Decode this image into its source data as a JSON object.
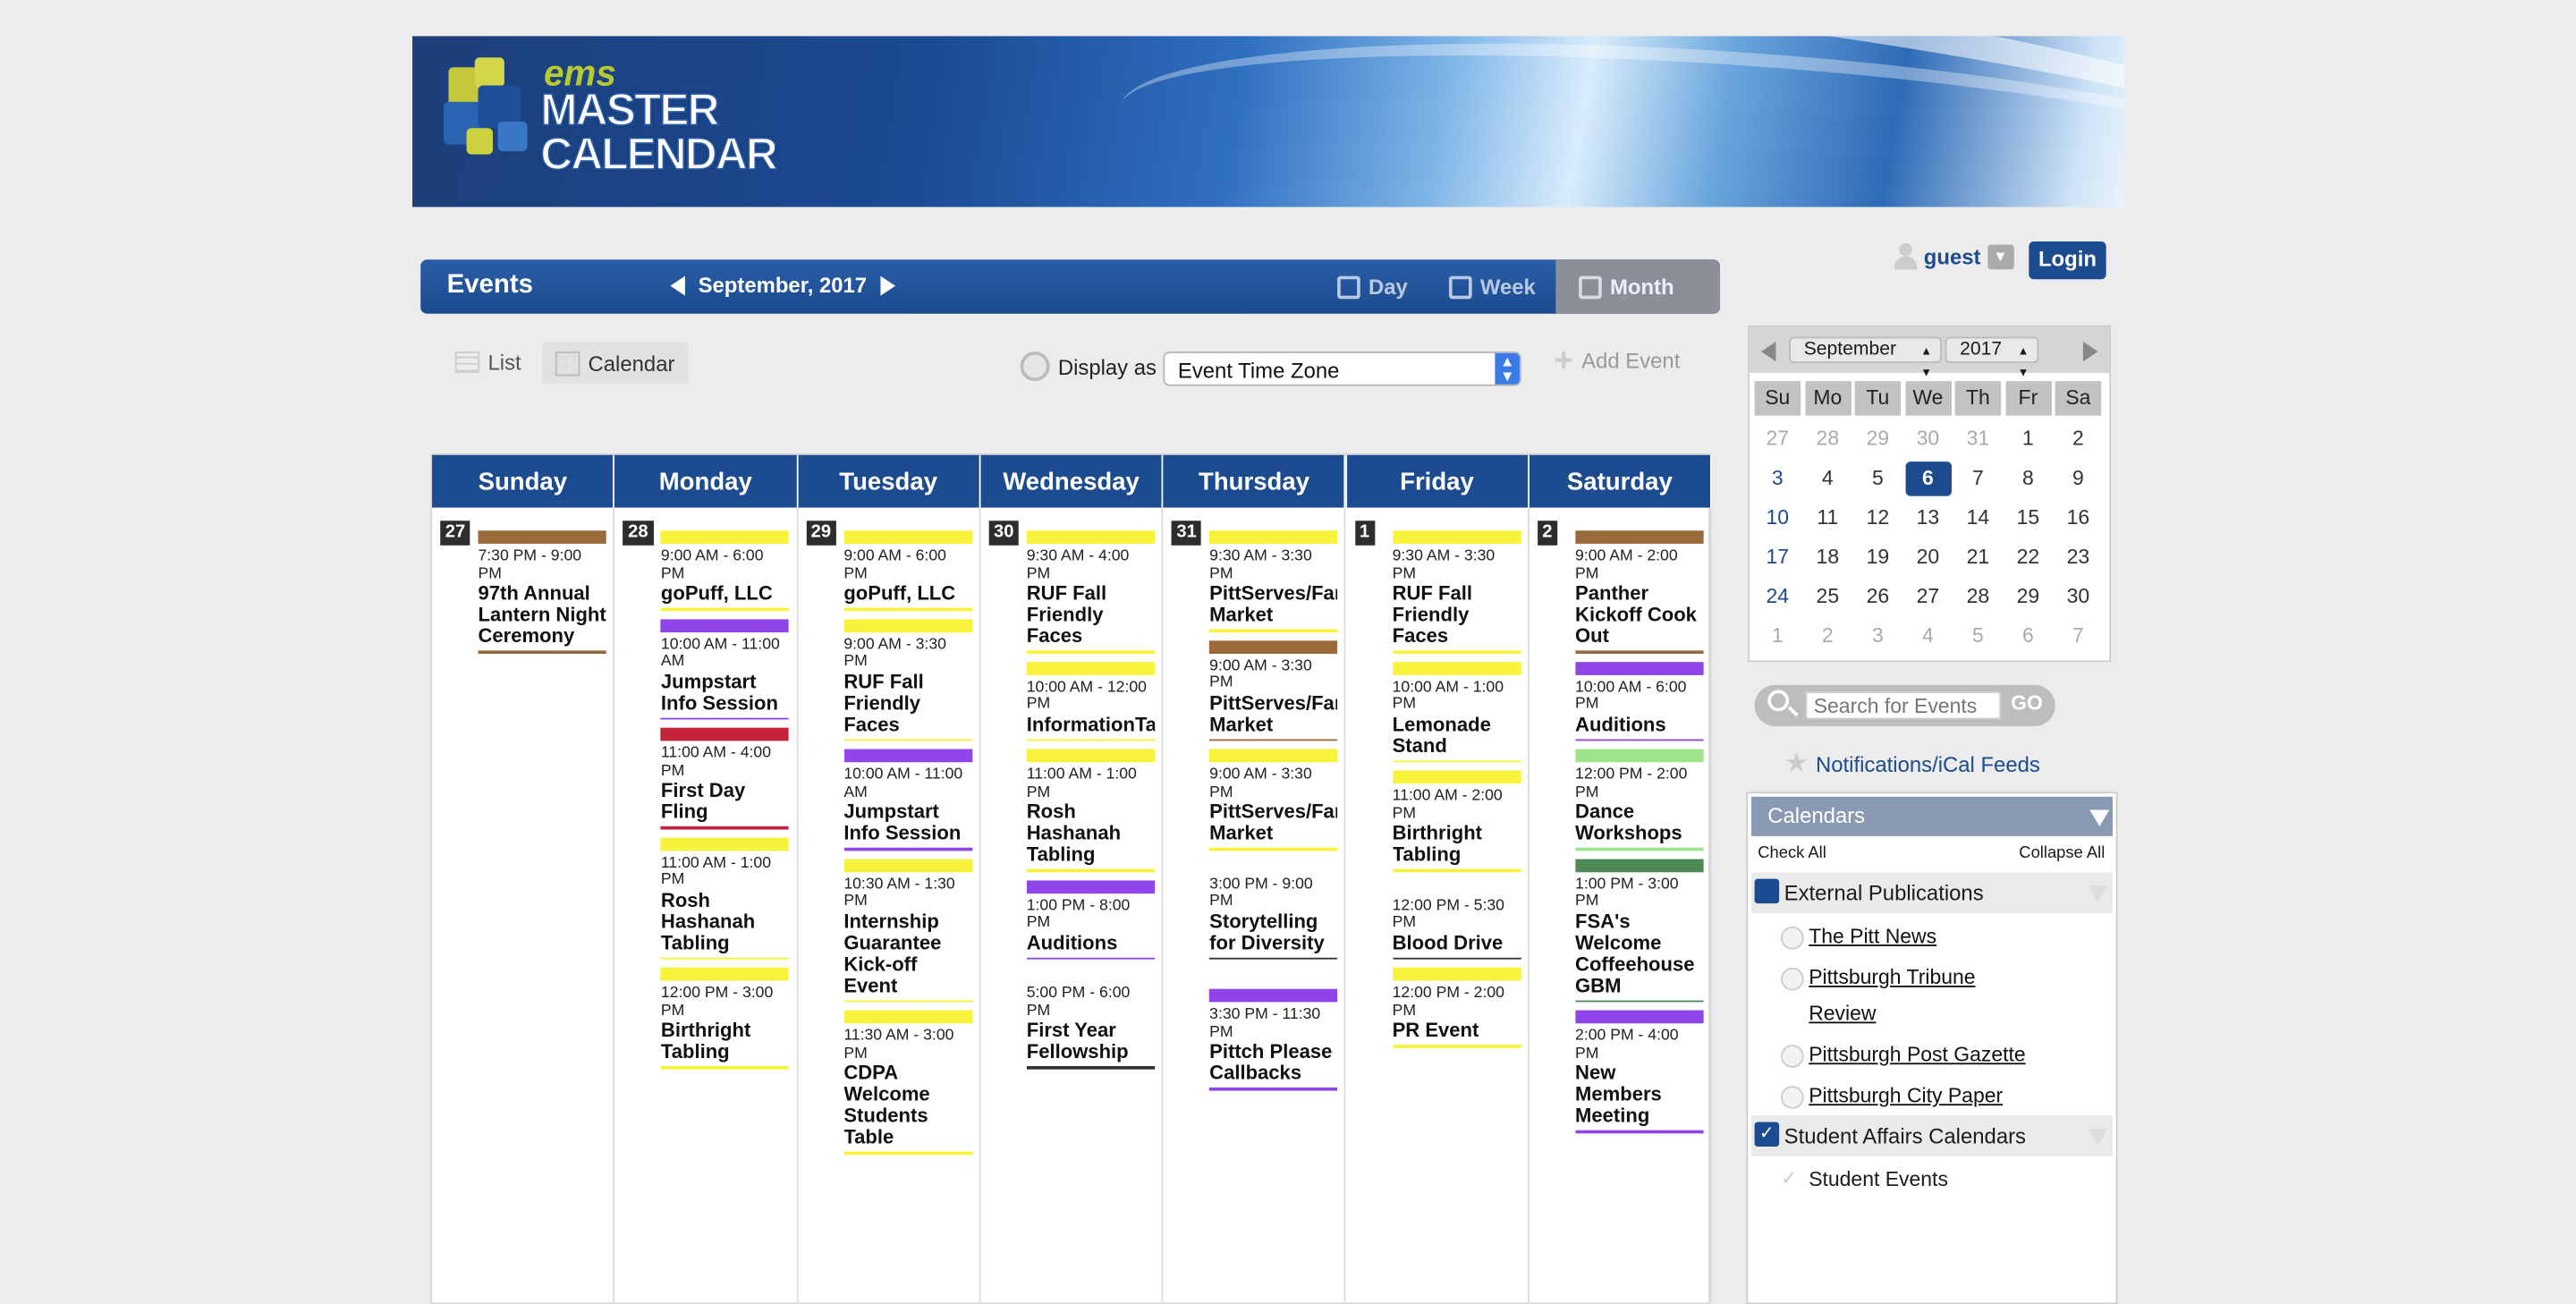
{
  "banner": {
    "logo_small": "ems",
    "logo_line1": "MASTER",
    "logo_line2": "CALENDAR"
  },
  "header": {
    "title": "Events",
    "month_label": "September, 2017",
    "views": [
      "Day",
      "Week",
      "Month"
    ],
    "active_view": "Month"
  },
  "toolbar": {
    "list_label": "List",
    "calendar_label": "Calendar",
    "display_as_label": "Display as",
    "timezone_value": "Event Time Zone",
    "add_event_label": "Add Event"
  },
  "user": {
    "name": "guest",
    "login_label": "Login"
  },
  "calendar": {
    "day_headers": [
      "Sunday",
      "Monday",
      "Tuesday",
      "Wednesday",
      "Thursday",
      "Friday",
      "Saturday"
    ],
    "days": [
      {
        "num": "27",
        "events": [
          {
            "time": "7:30 PM - 9:00 PM",
            "name": "97th Annual Lantern Night Ceremony",
            "color": "#9b6a3a"
          }
        ]
      },
      {
        "num": "28",
        "events": [
          {
            "time": "9:00 AM - 6:00 PM",
            "name": "goPuff, LLC",
            "color": "#f7f33b"
          },
          {
            "time": "10:00 AM - 11:00 AM",
            "name": "Jumpstart Info Session",
            "color": "#9045e8"
          },
          {
            "time": "11:00 AM - 4:00 PM",
            "name": "First Day Fling",
            "color": "#c4223b"
          },
          {
            "time": "11:00 AM - 1:00 PM",
            "name": "Rosh Hashanah Tabling",
            "color": "#f7f33b"
          },
          {
            "time": "12:00 PM - 3:00 PM",
            "name": "Birthright Tabling",
            "color": "#f7f33b"
          }
        ]
      },
      {
        "num": "29",
        "events": [
          {
            "time": "9:00 AM - 6:00 PM",
            "name": "goPuff, LLC",
            "color": "#f7f33b"
          },
          {
            "time": "9:00 AM - 3:30 PM",
            "name": "RUF Fall Friendly Faces",
            "color": "#f7f33b"
          },
          {
            "time": "10:00 AM - 11:00 AM",
            "name": "Jumpstart Info Session",
            "color": "#9045e8"
          },
          {
            "time": "10:30 AM - 1:30 PM",
            "name": "Internship Guarantee Kick-off Event",
            "color": "#f7f33b"
          },
          {
            "time": "11:30 AM - 3:00 PM",
            "name": "CDPA Welcome Students Table",
            "color": "#f7f33b"
          }
        ]
      },
      {
        "num": "30",
        "events": [
          {
            "time": "9:30 AM - 4:00 PM",
            "name": "RUF Fall Friendly Faces",
            "color": "#f7f33b"
          },
          {
            "time": "10:00 AM - 12:00 PM",
            "name": "InformationTabl",
            "color": "#f7f33b"
          },
          {
            "time": "11:00 AM - 1:00 PM",
            "name": "Rosh Hashanah Tabling",
            "color": "#f7f33b"
          },
          {
            "time": "1:00 PM - 8:00 PM",
            "name": "Auditions",
            "color": "#9045e8"
          },
          {
            "time": "5:00 PM - 6:00 PM",
            "name": "First Year Fellowship",
            "color": "#ffffff"
          }
        ]
      },
      {
        "num": "31",
        "events": [
          {
            "time": "9:30 AM - 3:30 PM",
            "name": "PittServes/Far Market",
            "color": "#f7f33b"
          },
          {
            "time": "9:00 AM - 3:30 PM",
            "name": "PittServes/Far Market",
            "color": "#9b6a3a"
          },
          {
            "time": "9:00 AM - 3:30 PM",
            "name": "PittServes/Far Market",
            "color": "#f7f33b"
          },
          {
            "time": "3:00 PM - 9:00 PM",
            "name": "Storytelling for Diversity",
            "color": "#ffffff"
          },
          {
            "time": "3:30 PM - 11:30 PM",
            "name": "Pittch Please Callbacks",
            "color": "#9045e8"
          }
        ]
      },
      {
        "num": "1",
        "events": [
          {
            "time": "9:30 AM - 3:30 PM",
            "name": "RUF Fall Friendly Faces",
            "color": "#f7f33b"
          },
          {
            "time": "10:00 AM - 1:00 PM",
            "name": "Lemonade Stand",
            "color": "#f7f33b"
          },
          {
            "time": "11:00 AM - 2:00 PM",
            "name": "Birthright Tabling",
            "color": "#f7f33b"
          },
          {
            "time": "12:00 PM - 5:30 PM",
            "name": "Blood Drive",
            "color": "#ffffff"
          },
          {
            "time": "12:00 PM - 2:00 PM",
            "name": "PR Event",
            "color": "#f7f33b"
          }
        ]
      },
      {
        "num": "2",
        "events": [
          {
            "time": "9:00 AM - 2:00 PM",
            "name": "Panther Kickoff Cook Out",
            "color": "#9b6a3a"
          },
          {
            "time": "10:00 AM - 6:00 PM",
            "name": "Auditions",
            "color": "#9045e8"
          },
          {
            "time": "12:00 PM - 2:00 PM",
            "name": "Dance Workshops",
            "color": "#9ee48a"
          },
          {
            "time": "1:00 PM - 3:00 PM",
            "name": "FSA's Welcome Coffeehouse GBM",
            "color": "#4e8a57"
          },
          {
            "time": "2:00 PM - 4:00 PM",
            "name": "New Members Meeting",
            "color": "#9045e8"
          }
        ]
      }
    ]
  },
  "mini_calendar": {
    "month": "September",
    "year": "2017",
    "weekdays": [
      "Su",
      "Mo",
      "Tu",
      "We",
      "Th",
      "Fr",
      "Sa"
    ],
    "weeks": [
      [
        "27",
        "28",
        "29",
        "30",
        "31",
        "1",
        "2"
      ],
      [
        "3",
        "4",
        "5",
        "6",
        "7",
        "8",
        "9"
      ],
      [
        "10",
        "11",
        "12",
        "13",
        "14",
        "15",
        "16"
      ],
      [
        "17",
        "18",
        "19",
        "20",
        "21",
        "22",
        "23"
      ],
      [
        "24",
        "25",
        "26",
        "27",
        "28",
        "29",
        "30"
      ],
      [
        "1",
        "2",
        "3",
        "4",
        "5",
        "6",
        "7"
      ]
    ],
    "today": "6"
  },
  "search": {
    "placeholder": "Search for Events",
    "go_label": "GO"
  },
  "notifications_label": "Notifications/iCal Feeds",
  "calendars_panel": {
    "title": "Calendars",
    "check_all": "Check All",
    "collapse_all": "Collapse All",
    "groups": [
      {
        "name": "External Publications",
        "items": [
          "The Pitt News",
          "Pittsburgh Tribune Review",
          "Pittsburgh Post Gazette",
          "Pittsburgh City Paper"
        ]
      },
      {
        "name": "Student Affairs Calendars",
        "items": [
          "Student Events"
        ]
      }
    ]
  }
}
